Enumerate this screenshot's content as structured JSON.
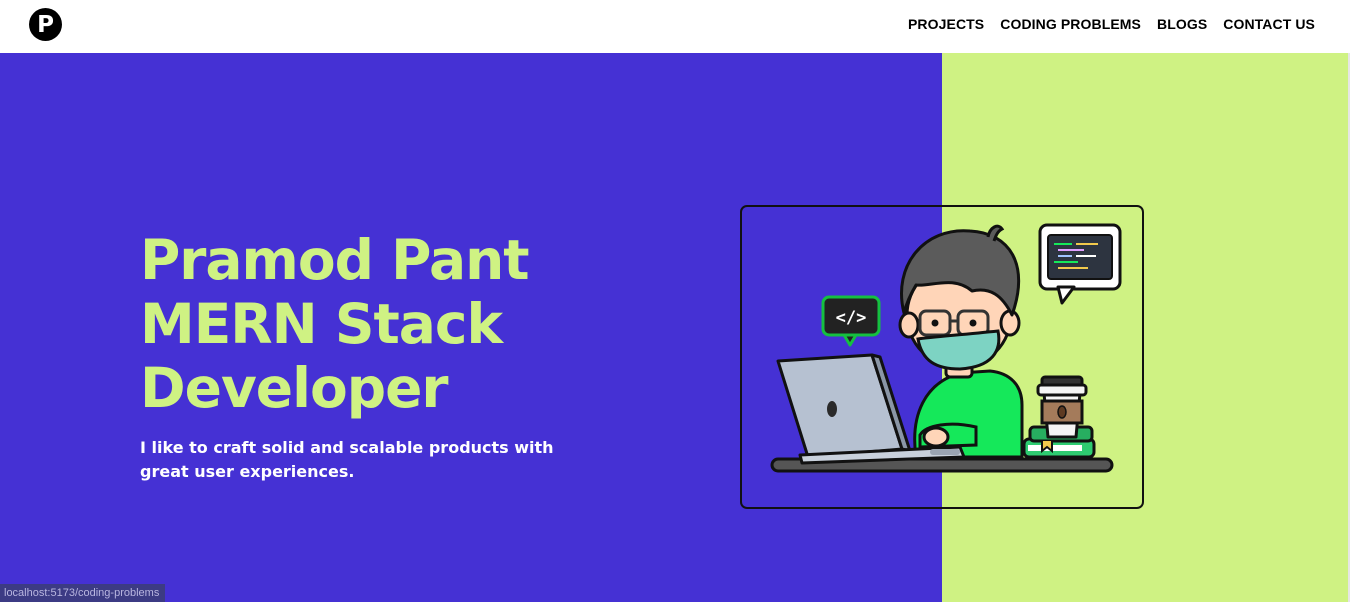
{
  "navbar": {
    "logo_letter": "P",
    "links": [
      "PROJECTS",
      "CODING PROBLEMS",
      "BLOGS",
      "CONTACT US"
    ]
  },
  "hero": {
    "headline": [
      "Pramod Pant",
      "MERN Stack",
      "Developer"
    ],
    "tagline": "I like to craft solid and scalable products with great user experiences.",
    "code_badge": "</>"
  },
  "status_bar": {
    "url": "localhost:5173/coding-problems"
  },
  "colors": {
    "hero_left_bg": "#4531d4",
    "hero_right_bg": "#cff283",
    "headline": "#cff283",
    "shirt": "#15e85a",
    "mask": "#7dd3c3"
  },
  "icons": [
    "logo-p-icon",
    "code-tag-icon",
    "code-window-icon",
    "coffee-cup-icon",
    "laptop-icon"
  ]
}
